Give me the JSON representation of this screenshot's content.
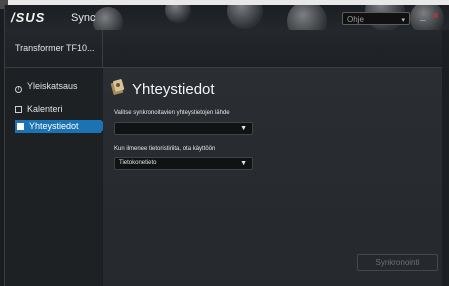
{
  "window": {
    "logo": "/SUS",
    "app_name": "Sync",
    "help_label": "Ohje",
    "minimize": "_",
    "close": "×"
  },
  "device": {
    "name": "Transformer TF10..."
  },
  "sidebar": {
    "items": [
      {
        "label": "Yleiskatsaus",
        "icon": "info-icon",
        "active": false
      },
      {
        "label": "Kalenteri",
        "icon": "calendar-icon",
        "active": false
      },
      {
        "label": "Yhteystiedot",
        "icon": "contacts-icon",
        "active": true
      }
    ]
  },
  "main": {
    "title": "Yhteystiedot",
    "source_label": "Valitse synkronoitavien yhteystietojen lähde",
    "source_value": "",
    "conflict_label": "Kun ilmenee tietoristiriita, ota käyttöön",
    "conflict_value": "Tietokonetieto",
    "sync_button": "Synkronointi"
  },
  "colors": {
    "accent": "#1b73b3",
    "close": "#d03030"
  }
}
